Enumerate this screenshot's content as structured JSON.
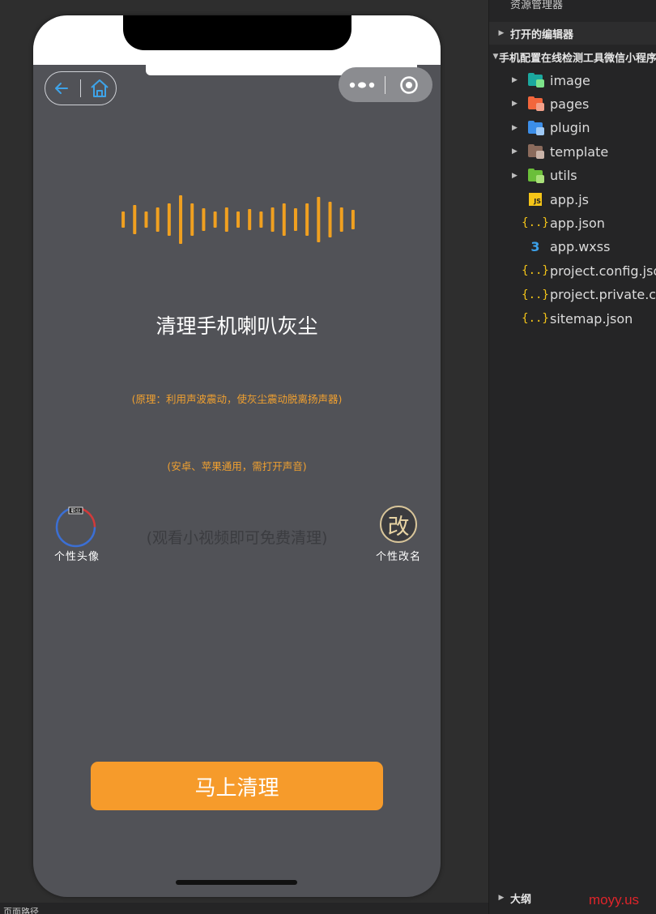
{
  "miniprogram": {
    "title": "清理手机喇叭灰尘",
    "principle": "(原理：利用声波震动，使灰尘震动脱离扬声器)",
    "compat": "(安卓、苹果通用，需打开声音)",
    "video_hint": "(观看小视频即可免费清理)",
    "avatar_label": "个性头像",
    "avatar_badge": "职业",
    "rename_label": "个性改名",
    "rename_char": "改",
    "clean_button": "马上清理",
    "accent_color": "#f69b2b",
    "icons": [
      "back-arrow-icon",
      "home-icon",
      "more-dots-icon",
      "close-target-icon",
      "sound-wave-icon"
    ]
  },
  "statusbar": {
    "left_text": "页面路径"
  },
  "explorer": {
    "header": "资源管理器",
    "open_editors": "打开的编辑器",
    "project_name": "手机配置在线检测工具微信小程序",
    "items": [
      {
        "label": "image",
        "type": "folder",
        "color": "#1ba89e",
        "badge_color": "#7de38a"
      },
      {
        "label": "pages",
        "type": "folder",
        "color": "#f2663c",
        "badge_color": "#f2a08a"
      },
      {
        "label": "plugin",
        "type": "folder",
        "color": "#3c8ee8",
        "badge_color": "#9fc9f5"
      },
      {
        "label": "template",
        "type": "folder",
        "color": "#8b6b5c",
        "badge_color": "#c9b3a8"
      },
      {
        "label": "utils",
        "type": "folder",
        "color": "#6bbf3a",
        "badge_color": "#a9e07a"
      },
      {
        "label": "app.js",
        "type": "js"
      },
      {
        "label": "app.json",
        "type": "json"
      },
      {
        "label": "app.wxss",
        "type": "wxss"
      },
      {
        "label": "project.config.json",
        "type": "json"
      },
      {
        "label": "project.private.config.json",
        "type": "json"
      },
      {
        "label": "sitemap.json",
        "type": "json"
      }
    ],
    "outline": "大纲"
  },
  "watermark": "moyy.us"
}
